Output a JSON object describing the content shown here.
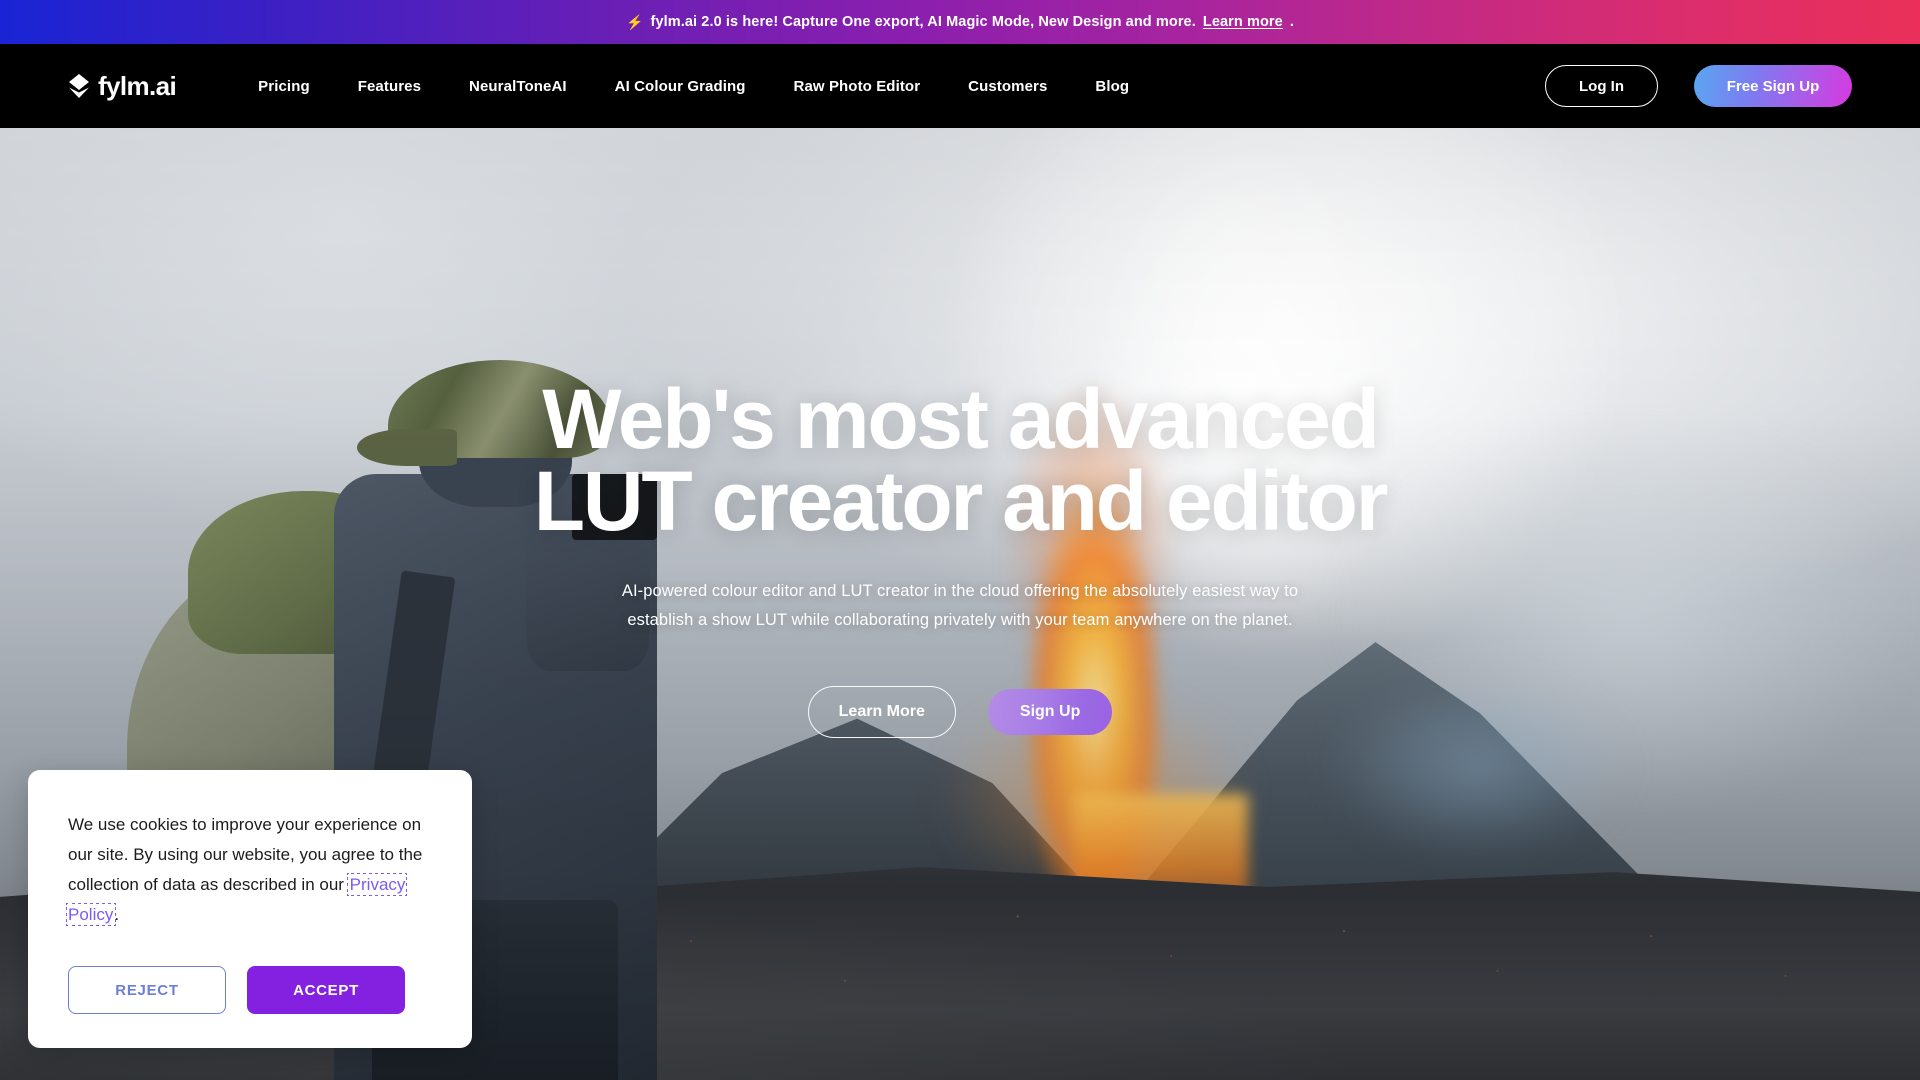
{
  "announcement": {
    "icon": "lightning-bolt-icon",
    "text": "fylm.ai 2.0 is here! Capture One export, AI Magic Mode, New Design and more.",
    "link_label": "Learn more",
    "trailing": ".",
    "gradient_start": "#1a24d4",
    "gradient_end": "#ea3059"
  },
  "nav": {
    "logo_icon": "fylm-diamond-logo-icon",
    "logo_text": "fylm.ai",
    "links": [
      {
        "label": "Pricing"
      },
      {
        "label": "Features"
      },
      {
        "label": "NeuralToneAI"
      },
      {
        "label": "AI Colour Grading"
      },
      {
        "label": "Raw Photo Editor"
      },
      {
        "label": "Customers"
      },
      {
        "label": "Blog"
      }
    ],
    "login_label": "Log In",
    "signup_label": "Free Sign Up",
    "background": "#000000",
    "signup_gradient_start": "#59a7f0",
    "signup_gradient_end": "#d63ae0"
  },
  "hero": {
    "title_line1": "Web's most advanced",
    "title_line2": "LUT creator and editor",
    "subtitle_line1": "AI-powered colour editor and LUT creator in the cloud offering the absolutely easiest way to",
    "subtitle_line2": "establish a show LUT while collaborating privately with your team anywhere on the planet.",
    "cta_outline_label": "Learn More",
    "cta_primary_label": "Sign Up",
    "cta_primary_color": "#a87ee6",
    "background_description": "Photographer with backpack and camera in front of an erupting volcano with lava fountain and ash plume"
  },
  "cookie_banner": {
    "text_part1": "We use cookies to improve your experience on our site. By using our website, you agree to the collection of data as described in our ",
    "link_label": "Privacy Policy",
    "text_part2": ".",
    "reject_label": "REJECT",
    "accept_label": "ACCEPT",
    "accept_color": "#8421e0",
    "reject_border_color": "#6b7fd7",
    "link_color": "#7b5cf0"
  }
}
